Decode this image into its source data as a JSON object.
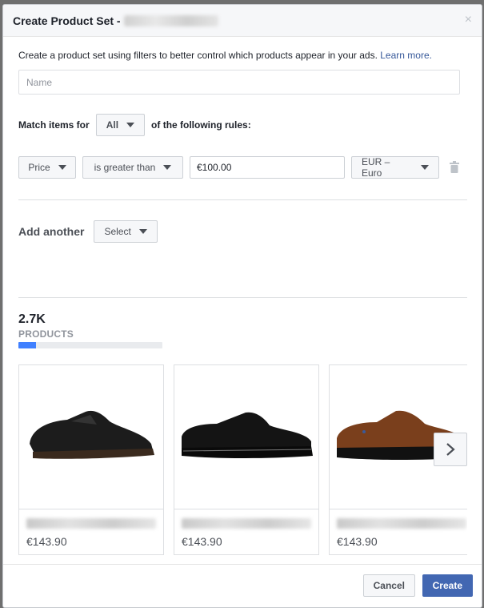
{
  "dialog": {
    "title": "Create Product Set - ",
    "close_label": "×"
  },
  "intro": {
    "text": "Create a product set using filters to better control which products appear in your ads. ",
    "link": "Learn more."
  },
  "name_field": {
    "placeholder": "Name",
    "value": ""
  },
  "match": {
    "prefix": "Match items for",
    "mode": "All",
    "suffix": "of the following rules:"
  },
  "rule": {
    "field": "Price",
    "operator": "is greater than",
    "value": "€100.00",
    "currency": "EUR – Euro"
  },
  "add_another": {
    "label": "Add another",
    "select": "Select"
  },
  "products": {
    "count": "2.7K",
    "label": "PRODUCTS",
    "progress": 0.12,
    "items": [
      {
        "price": "€143.90"
      },
      {
        "price": "€143.90"
      },
      {
        "price": "€143.90"
      }
    ]
  },
  "footer": {
    "cancel": "Cancel",
    "create": "Create"
  },
  "colors": {
    "accent": "#4267b2",
    "progress": "#4080ff",
    "link": "#365899"
  }
}
